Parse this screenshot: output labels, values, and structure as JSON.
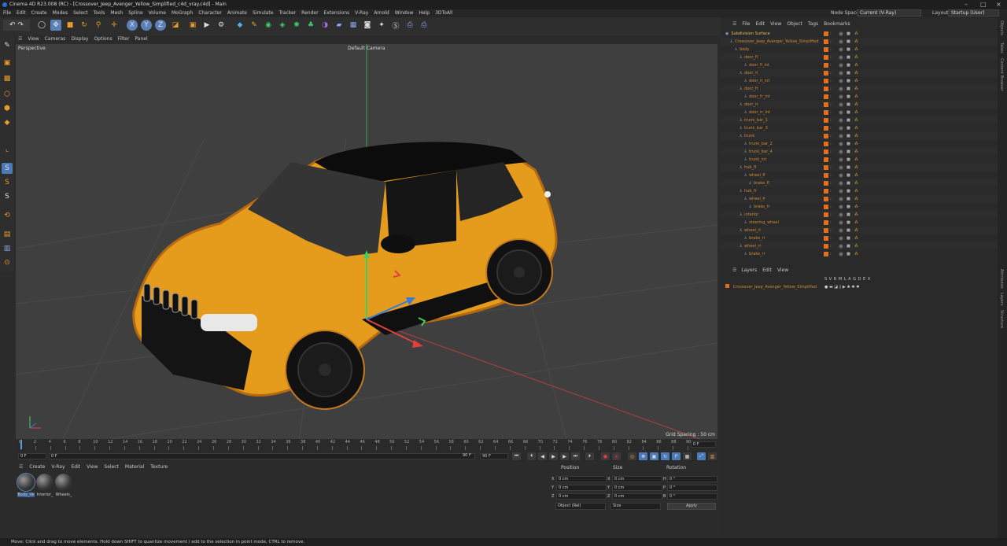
{
  "window": {
    "title": "Cinema 4D R23.008 (RC) - [Crossover_Jeep_Avenger_Yellow_Simplified_c4d_vray.c4d] - Main"
  },
  "menubar": {
    "items": [
      "File",
      "Edit",
      "Create",
      "Modes",
      "Select",
      "Tools",
      "Mesh",
      "Spline",
      "Volume",
      "MoGraph",
      "Character",
      "Animate",
      "Simulate",
      "Tracker",
      "Render",
      "Extensions",
      "V-Ray",
      "Arnold",
      "Window",
      "Help",
      "3DToAll"
    ],
    "node_space_label": "Node Space:",
    "node_space_value": "Current (V-Ray)",
    "layout_label": "Layout:",
    "layout_value": "Startup (User)"
  },
  "toolbar": {
    "axis_x": "X",
    "axis_y": "Y",
    "axis_z": "Z"
  },
  "viewport": {
    "menu": [
      "View",
      "Cameras",
      "Display",
      "Options",
      "Filter",
      "Panel"
    ],
    "view_name": "Perspective",
    "camera": "Default Camera",
    "grid_spacing": "Grid Spacing : 50 cm"
  },
  "timeline": {
    "ticks": [
      "0",
      "2",
      "4",
      "6",
      "8",
      "10",
      "12",
      "14",
      "16",
      "18",
      "20",
      "22",
      "24",
      "26",
      "28",
      "30",
      "32",
      "34",
      "36",
      "38",
      "40",
      "42",
      "44",
      "46",
      "48",
      "50",
      "52",
      "54",
      "56",
      "58",
      "60",
      "62",
      "64",
      "66",
      "68",
      "70",
      "72",
      "74",
      "76",
      "78",
      "80",
      "82",
      "84",
      "86",
      "88",
      "90"
    ],
    "current_frame": "0 F"
  },
  "transport": {
    "start": "0 F",
    "preview_start": "0 F",
    "preview_end": "90 F",
    "end": "90 F"
  },
  "materials": {
    "menu": [
      "Create",
      "V-Ray",
      "Edit",
      "View",
      "Select",
      "Material",
      "Texture"
    ],
    "items": [
      "Body_Ve",
      "Interior_",
      "Wheels_"
    ]
  },
  "attributes": {
    "headers": {
      "position": "Position",
      "size": "Size",
      "rotation": "Rotation"
    },
    "rows": [
      {
        "axis": "X",
        "pos": "0 cm",
        "size_axis": "X",
        "size": "0 cm",
        "rot_axis": "H",
        "rot": "0 °"
      },
      {
        "axis": "Y",
        "pos": "0 cm",
        "size_axis": "Y",
        "size": "0 cm",
        "rot_axis": "P",
        "rot": "0 °"
      },
      {
        "axis": "Z",
        "pos": "0 cm",
        "size_axis": "Z",
        "size": "0 cm",
        "rot_axis": "B",
        "rot": "0 °"
      }
    ],
    "mode_select": "Object (Rel)",
    "size_select": "Size",
    "apply": "Apply"
  },
  "objects": {
    "menu": [
      "File",
      "Edit",
      "View",
      "Object",
      "Tags",
      "Bookmarks"
    ],
    "rows": [
      {
        "name": "Subdivision Surface",
        "level": 0,
        "color": "#e0c060"
      },
      {
        "name": "Crossover_Jeep_Avenger_Yellow_Simplified",
        "level": 1
      },
      {
        "name": "body",
        "level": 2
      },
      {
        "name": "door_fl",
        "level": 3
      },
      {
        "name": "door_fl_int",
        "level": 4
      },
      {
        "name": "door_rl",
        "level": 3
      },
      {
        "name": "door_rl_int",
        "level": 4
      },
      {
        "name": "door_fr",
        "level": 3
      },
      {
        "name": "door_fr_int",
        "level": 4
      },
      {
        "name": "door_rr",
        "level": 3
      },
      {
        "name": "door_rr_int",
        "level": 4
      },
      {
        "name": "trunk_bar_1",
        "level": 3
      },
      {
        "name": "trunk_bar_3",
        "level": 3
      },
      {
        "name": "trunk",
        "level": 3
      },
      {
        "name": "trunk_bar_2",
        "level": 4
      },
      {
        "name": "trunk_bar_4",
        "level": 4
      },
      {
        "name": "trunk_int",
        "level": 4
      },
      {
        "name": "hub_fl",
        "level": 3
      },
      {
        "name": "wheel_fl",
        "level": 4
      },
      {
        "name": "brake_fl",
        "level": 5
      },
      {
        "name": "hub_fr",
        "level": 3
      },
      {
        "name": "wheel_fr",
        "level": 4
      },
      {
        "name": "brake_fr",
        "level": 5
      },
      {
        "name": "interior",
        "level": 3
      },
      {
        "name": "steering_wheel",
        "level": 4
      },
      {
        "name": "wheel_rl",
        "level": 3
      },
      {
        "name": "brake_rl",
        "level": 4
      },
      {
        "name": "wheel_rr",
        "level": 3
      },
      {
        "name": "brake_rr",
        "level": 4
      }
    ]
  },
  "layers": {
    "menu": [
      "Layers",
      "Edit",
      "View"
    ],
    "columns": "S V R M L A G D E X",
    "items": [
      "Crossover_Jeep_Avenger_Yellow_Simplified"
    ]
  },
  "right_tabs": [
    "Objects",
    "Takes",
    "Content Browser",
    "Attributes",
    "Layers",
    "Structure"
  ],
  "status": {
    "text": "Move: Click and drag to move elements. Hold down SHIFT to quantize movement / add to the selection in point mode, CTRL to remove."
  }
}
